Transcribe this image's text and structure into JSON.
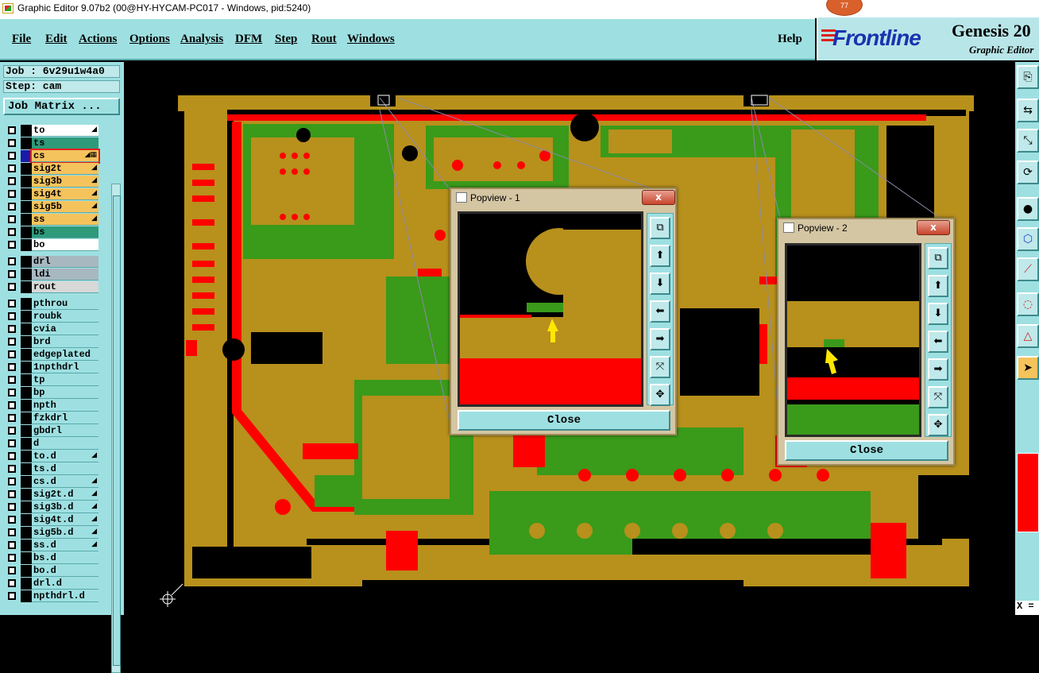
{
  "window": {
    "title": "Graphic Editor 9.07b2 (00@HY-HYCAM-PC017 - Windows, pid:5240)",
    "badge": "77"
  },
  "menu": [
    "File",
    "Edit",
    "Actions",
    "Options",
    "Analysis",
    "DFM",
    "Step",
    "Rout",
    "Windows"
  ],
  "help_label": "Help",
  "logo": {
    "brand": "Frontline",
    "product": "Genesis 20",
    "subtitle": "Graphic Editor"
  },
  "job_label": "Job : 6v29u1w4a0",
  "step_label": "Step: cam",
  "job_matrix_button": "Job Matrix ...",
  "layers": [
    {
      "name": "to",
      "color": "#ffffff",
      "marker": "◢",
      "active": false
    },
    {
      "name": "ts",
      "color": "#2e9a7a",
      "marker": "",
      "active": false
    },
    {
      "name": "cs",
      "color": "#f5c35c",
      "marker": "◢▦",
      "active": true
    },
    {
      "name": "sig2t",
      "color": "#f5c35c",
      "marker": "◢",
      "active": false
    },
    {
      "name": "sig3b",
      "color": "#f5c35c",
      "marker": "◢",
      "active": false
    },
    {
      "name": "sig4t",
      "color": "#f5c35c",
      "marker": "◢",
      "active": false
    },
    {
      "name": "sig5b",
      "color": "#f5c35c",
      "marker": "◢",
      "active": false
    },
    {
      "name": "ss",
      "color": "#f5c35c",
      "marker": "◢",
      "active": false
    },
    {
      "name": "bs",
      "color": "#2e9a7a",
      "marker": "",
      "active": false
    },
    {
      "name": "bo",
      "color": "#ffffff",
      "marker": "",
      "active": false
    },
    {
      "name": "drl",
      "color": "#a8b8c0",
      "marker": "",
      "active": false
    },
    {
      "name": "ldi",
      "color": "#a8b8c0",
      "marker": "",
      "active": false
    },
    {
      "name": "rout",
      "color": "#d8d8d8",
      "marker": "",
      "active": false
    },
    {
      "name": "pthrou",
      "color": "#9ee0e2",
      "marker": "",
      "active": false
    },
    {
      "name": "roubk",
      "color": "#9ee0e2",
      "marker": "",
      "active": false
    },
    {
      "name": "cvia",
      "color": "#9ee0e2",
      "marker": "",
      "active": false
    },
    {
      "name": "brd",
      "color": "#9ee0e2",
      "marker": "",
      "active": false
    },
    {
      "name": "edgeplated",
      "color": "#9ee0e2",
      "marker": "",
      "active": false
    },
    {
      "name": "1npthdrl",
      "color": "#9ee0e2",
      "marker": "",
      "active": false
    },
    {
      "name": "tp",
      "color": "#9ee0e2",
      "marker": "",
      "active": false
    },
    {
      "name": "bp",
      "color": "#9ee0e2",
      "marker": "",
      "active": false
    },
    {
      "name": "npth",
      "color": "#9ee0e2",
      "marker": "",
      "active": false
    },
    {
      "name": "fzkdrl",
      "color": "#9ee0e2",
      "marker": "",
      "active": false
    },
    {
      "name": "gbdrl",
      "color": "#9ee0e2",
      "marker": "",
      "active": false
    },
    {
      "name": "d",
      "color": "#9ee0e2",
      "marker": "",
      "active": false
    },
    {
      "name": "to.d",
      "color": "#9ee0e2",
      "marker": "◢",
      "active": false
    },
    {
      "name": "ts.d",
      "color": "#9ee0e2",
      "marker": "",
      "active": false
    },
    {
      "name": "cs.d",
      "color": "#9ee0e2",
      "marker": "◢",
      "active": false
    },
    {
      "name": "sig2t.d",
      "color": "#9ee0e2",
      "marker": "◢",
      "active": false
    },
    {
      "name": "sig3b.d",
      "color": "#9ee0e2",
      "marker": "◢",
      "active": false
    },
    {
      "name": "sig4t.d",
      "color": "#9ee0e2",
      "marker": "◢",
      "active": false
    },
    {
      "name": "sig5b.d",
      "color": "#9ee0e2",
      "marker": "◢",
      "active": false
    },
    {
      "name": "ss.d",
      "color": "#9ee0e2",
      "marker": "◢",
      "active": false
    },
    {
      "name": "bs.d",
      "color": "#9ee0e2",
      "marker": "",
      "active": false
    },
    {
      "name": "bo.d",
      "color": "#9ee0e2",
      "marker": "",
      "active": false
    },
    {
      "name": "drl.d",
      "color": "#9ee0e2",
      "marker": "",
      "active": false
    },
    {
      "name": "npthdrl.d",
      "color": "#9ee0e2",
      "marker": "",
      "active": false
    }
  ],
  "popview1": {
    "title": "Popview - 1",
    "close_label": "Close",
    "close_x": "x"
  },
  "popview2": {
    "title": "Popview - 2",
    "close_label": "Close",
    "close_x": "x"
  },
  "coord_label": "X =",
  "colors": {
    "panel": "#9ee0e2",
    "copper": "#b8901c",
    "green": "#3a9a1a",
    "red": "#f00000",
    "board_bg": "#000000"
  }
}
